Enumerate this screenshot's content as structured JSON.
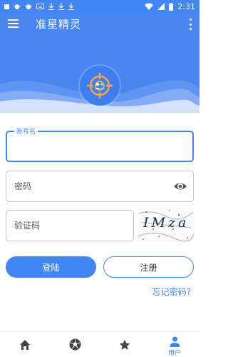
{
  "status_bar": {
    "time": "2:31",
    "left_icons": [
      "square-icon",
      "bug-icon",
      "bug-icon",
      "keyboard-icon",
      "download-icon",
      "download-icon",
      "download-icon"
    ],
    "right_icons": [
      "wifi-icon",
      "signal-icon",
      "battery-icon"
    ]
  },
  "app_bar": {
    "title": "准星精灵"
  },
  "form": {
    "account": {
      "label": "账号名",
      "value": ""
    },
    "password": {
      "placeholder": "密码"
    },
    "captcha": {
      "placeholder": "验证码",
      "image_text": "IMza"
    }
  },
  "buttons": {
    "login": "登陆",
    "register": "注册"
  },
  "forgot_password": "忘记密码?",
  "bottom_nav": {
    "items": [
      {
        "icon": "home-icon",
        "label": ""
      },
      {
        "icon": "soccer-ball-icon",
        "label": ""
      },
      {
        "icon": "star-icon",
        "label": ""
      },
      {
        "icon": "user-icon",
        "label": "用户",
        "active": true
      }
    ]
  },
  "colors": {
    "primary": "#4285f4",
    "header_bg": "#4a86f0",
    "text": "#333333"
  }
}
